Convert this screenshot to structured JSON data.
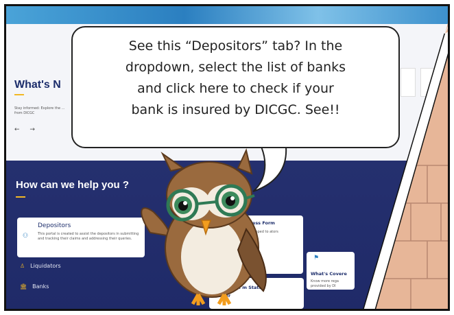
{
  "speech_bubble": {
    "lines": [
      "See this “Depositors” tab? In the",
      "dropdown, select the list of banks",
      "and click here to check if your",
      "bank is insured by DICGC. See!!"
    ]
  },
  "website": {
    "whats_new_title": "What's N",
    "stay_informed_text": "Stay informed: Explore the ... from DICGC",
    "nav_arrows": "← →",
    "help_title": "How can we help you ?",
    "depositors_card": {
      "title": "Depositors",
      "description": "This portal is created to assist the depositors in submitting and tracking their claims and addressing their queries."
    },
    "menu_items": [
      {
        "icon": "person-icon",
        "label": "Liquidators"
      },
      {
        "icon": "bank-icon",
        "label": "Banks"
      }
    ],
    "cards": {
      "form_title": "ngness Form",
      "form_text": "n developed to ators",
      "covered_title": "What's Covere",
      "covered_text": "Know more rega provided by DI",
      "read_more": "Read more ›",
      "status_title": "Do... Soc... m Status",
      "status_sub": "Tr...ker"
    }
  },
  "colors": {
    "navy": "#25306f",
    "accent_yellow": "#f2b824",
    "brick": "#e8b89a",
    "owl_brown": "#9a6a3e",
    "glasses_green": "#2f7a55"
  }
}
